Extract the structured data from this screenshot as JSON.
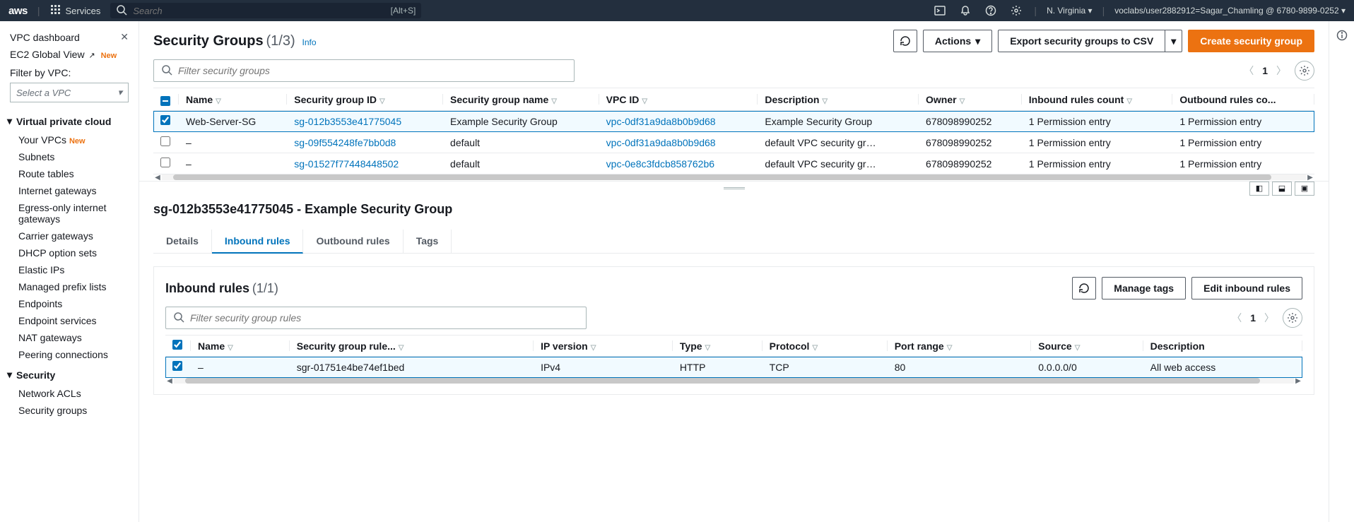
{
  "nav": {
    "logo": "aws",
    "services": "Services",
    "search_placeholder": "Search",
    "search_shortcut": "[Alt+S]",
    "region": "N. Virginia",
    "account": "voclabs/user2882912=Sagar_Chamling @ 6780-9899-0252"
  },
  "sidebar": {
    "dashboard": "VPC dashboard",
    "global_view": "EC2 Global View",
    "new_badge": "New",
    "filter_label": "Filter by VPC:",
    "select_placeholder": "Select a VPC",
    "sections": {
      "vpc": {
        "title": "Virtual private cloud",
        "items": [
          "Your VPCs",
          "Subnets",
          "Route tables",
          "Internet gateways",
          "Egress-only internet gateways",
          "Carrier gateways",
          "DHCP option sets",
          "Elastic IPs",
          "Managed prefix lists",
          "Endpoints",
          "Endpoint services",
          "NAT gateways",
          "Peering connections"
        ]
      },
      "security": {
        "title": "Security",
        "items": [
          "Network ACLs",
          "Security groups"
        ]
      }
    }
  },
  "page": {
    "title": "Security Groups",
    "count": "(1/3)",
    "info": "Info",
    "actions": {
      "actions": "Actions",
      "export": "Export security groups to CSV",
      "create": "Create security group"
    },
    "filter_placeholder": "Filter security groups",
    "page_num": "1",
    "columns": [
      "Name",
      "Security group ID",
      "Security group name",
      "VPC ID",
      "Description",
      "Owner",
      "Inbound rules count",
      "Outbound rules co..."
    ],
    "rows": [
      {
        "selected": true,
        "name": "Web-Server-SG",
        "sg": "sg-012b3553e41775045",
        "sgname": "Example Security Group",
        "vpc": "vpc-0df31a9da8b0b9d68",
        "desc": "Example Security Group",
        "owner": "678098990252",
        "inbound": "1 Permission entry",
        "outbound": "1 Permission entry"
      },
      {
        "selected": false,
        "name": "–",
        "sg": "sg-09f554248fe7bb0d8",
        "sgname": "default",
        "vpc": "vpc-0df31a9da8b0b9d68",
        "desc": "default VPC security gr…",
        "owner": "678098990252",
        "inbound": "1 Permission entry",
        "outbound": "1 Permission entry"
      },
      {
        "selected": false,
        "name": "–",
        "sg": "sg-01527f77448448502",
        "sgname": "default",
        "vpc": "vpc-0e8c3fdcb858762b6",
        "desc": "default VPC security gr…",
        "owner": "678098990252",
        "inbound": "1 Permission entry",
        "outbound": "1 Permission entry"
      }
    ]
  },
  "detail": {
    "title": "sg-012b3553e41775045 - Example Security Group",
    "tabs": [
      "Details",
      "Inbound rules",
      "Outbound rules",
      "Tags"
    ],
    "active_tab": 1,
    "inbound": {
      "title": "Inbound rules",
      "count": "(1/1)",
      "buttons": {
        "manage": "Manage tags",
        "edit": "Edit inbound rules"
      },
      "filter_placeholder": "Filter security group rules",
      "page_num": "1",
      "columns": [
        "Name",
        "Security group rule...",
        "IP version",
        "Type",
        "Protocol",
        "Port range",
        "Source",
        "Description"
      ],
      "row": {
        "name": "–",
        "sgr": "sgr-01751e4be74ef1bed",
        "ipv": "IPv4",
        "type": "HTTP",
        "proto": "TCP",
        "port": "80",
        "source": "0.0.0.0/0",
        "desc": "All web access"
      }
    }
  }
}
